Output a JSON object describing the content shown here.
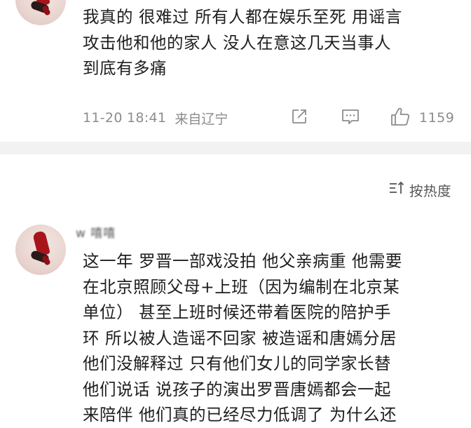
{
  "comments": [
    {
      "text": "我真的 很难过 所有人都在娱乐至死 用谣言\n攻击他和他的家人 没人在意这几天当事人\n到底有多痛",
      "time": "11-20 18:41",
      "location": "来自辽宁",
      "likes": "1159",
      "icons": {
        "share": "share-icon",
        "reply": "comment-icon",
        "like": "thumbs-up-icon"
      }
    },
    {
      "username": "w 嘻嘻",
      "text": "这一年 罗晋一部戏没拍 他父亲病重 他需要\n在北京照顾父母+上班（因为编制在北京某\n单位） 甚至上班时候还带着医院的陪护手\n环 所以被人造谣不回家 被造谣和唐嫣分居\n他们没解释过 只有他们女儿的同学家长替\n他们说话 说孩子的演出罗晋唐嫣都会一起\n来陪伴 他们真的已经尽力低调了 为什么还"
    }
  ],
  "sort": {
    "label": "按热度",
    "icon": "sort-icon"
  },
  "colors": {
    "meta_gray": "#8c8c8c",
    "band": "#f2f2f2",
    "avatar_red": "#a8141c"
  }
}
